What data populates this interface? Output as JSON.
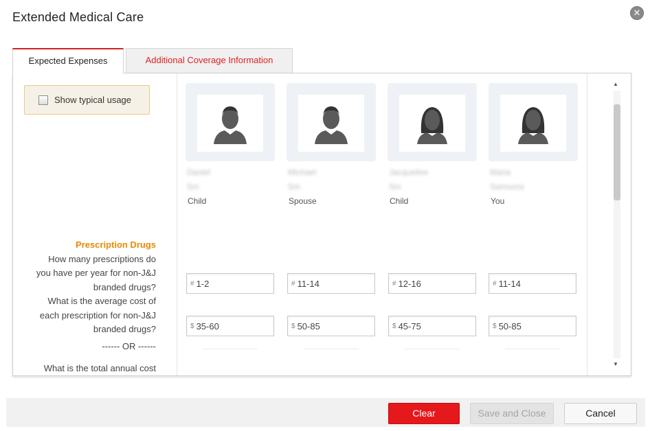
{
  "dialog": {
    "title": "Extended Medical Care",
    "close_icon": "close-circle-icon"
  },
  "tabs": [
    {
      "label": "Expected Expenses",
      "active": true
    },
    {
      "label": "Additional Coverage Information",
      "active": false
    }
  ],
  "show_usage": {
    "label": "Show typical usage",
    "checked": false
  },
  "section": {
    "title": "Prescription Drugs",
    "question1": "How many prescriptions do you have per year for non-J&J branded drugs?",
    "question2": "What is the average cost of each prescription for non-J&J branded drugs?",
    "separator": "------ OR ------",
    "question3": "What is the total annual cost"
  },
  "members": [
    {
      "name_line1": "Daniel",
      "name_line2": "Sm",
      "relation": "Child",
      "avatar": "male-person-icon",
      "count_prefix": "#",
      "count": "1-2",
      "cost_prefix": "$",
      "cost": "35-60"
    },
    {
      "name_line1": "Michael",
      "name_line2": "Sm",
      "relation": "Spouse",
      "avatar": "male-person-icon",
      "count_prefix": "#",
      "count": "11-14",
      "cost_prefix": "$",
      "cost": "50-85"
    },
    {
      "name_line1": "Jacqueline",
      "name_line2": "Sm",
      "relation": "Child",
      "avatar": "female-person-icon",
      "count_prefix": "#",
      "count": "12-16",
      "cost_prefix": "$",
      "cost": "45-75"
    },
    {
      "name_line1": "Maria",
      "name_line2": "Samsons",
      "relation": "You",
      "avatar": "female-person-icon",
      "count_prefix": "#",
      "count": "11-14",
      "cost_prefix": "$",
      "cost": "50-85"
    }
  ],
  "footer": {
    "clear_label": "Clear",
    "save_label": "Save and Close",
    "cancel_label": "Cancel"
  },
  "colors": {
    "accent_red": "#e5181b",
    "section_orange": "#e68a00",
    "avatar_gray": "#5a5a5a"
  }
}
